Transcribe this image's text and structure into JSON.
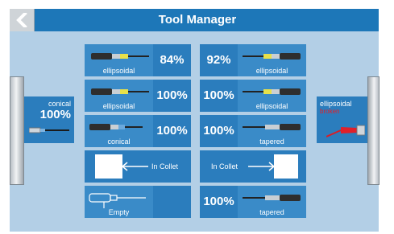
{
  "app": {
    "title": "Tool Manager"
  },
  "header": {
    "back_icon": "chevron-left-icon"
  },
  "left_spindle": {
    "tool_name": "conical",
    "percent": "100%"
  },
  "right_spindle": {
    "tool_name": "ellipsoidal",
    "status": "broken"
  },
  "slots_left": [
    {
      "name": "ellipsoidal",
      "percent": "84%"
    },
    {
      "name": "ellipsoidal",
      "percent": "100%"
    },
    {
      "name": "conical",
      "percent": "100%"
    },
    {
      "label": "In Collet"
    },
    {
      "name": "Empty"
    }
  ],
  "slots_right": [
    {
      "name": "ellipsoidal",
      "percent": "92%"
    },
    {
      "name": "ellipsoidal",
      "percent": "100%"
    },
    {
      "name": "tapered",
      "percent": "100%"
    },
    {
      "label": "In Collet"
    },
    {
      "name": "tapered",
      "percent": "100%"
    }
  ],
  "colors": {
    "header": "#1d77b8",
    "tile": "#2b7dbd",
    "background": "#b3cfe6",
    "broken": "#e0202a"
  }
}
